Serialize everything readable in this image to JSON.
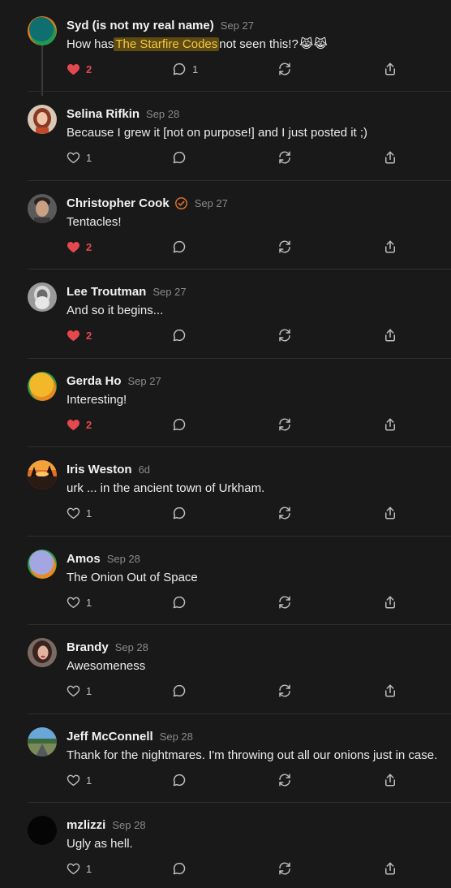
{
  "colors": {
    "background": "#191919",
    "accent_like": "#e5484d",
    "highlight_bg": "#5e4b12",
    "highlight_text": "#f6c744",
    "muted": "#8a8a8a"
  },
  "comments": [
    {
      "author": "Syd (is not my real name)",
      "date": "Sep 27",
      "text_before": "How has ",
      "highlight": "The Starfire Codes",
      "text_after": " not seen this!?",
      "emoji": "😹😹",
      "likes": "2",
      "liked": true,
      "replies": "1",
      "verified": false,
      "avatar": "teal-green-orange-circle"
    },
    {
      "author": "Selina Rifkin",
      "date": "Sep 28",
      "text": "Because I grew it [not on purpose!] and I just posted it ;)",
      "likes": "1",
      "liked": false,
      "replies": "",
      "verified": false,
      "avatar": "photo-woman-red-hair"
    },
    {
      "author": "Christopher Cook",
      "date": "Sep 27",
      "text": "Tentacles!",
      "likes": "2",
      "liked": true,
      "replies": "",
      "verified": true,
      "avatar": "photo-man-dark-hair"
    },
    {
      "author": "Lee Troutman",
      "date": "Sep 27",
      "text": "And so it begins...",
      "likes": "2",
      "liked": true,
      "replies": "",
      "verified": false,
      "avatar": "photo-grey-beard-bw"
    },
    {
      "author": "Gerda Ho",
      "date": "Sep 27",
      "text": "Interesting!",
      "likes": "2",
      "liked": true,
      "replies": "",
      "verified": false,
      "avatar": "yellow-orange-green-circle"
    },
    {
      "author": "Iris Weston",
      "date": "6d",
      "text": "urk ... in the ancient town of Urkham.",
      "likes": "1",
      "liked": false,
      "replies": "",
      "verified": false,
      "avatar": "photo-sunset-trees"
    },
    {
      "author": "Amos",
      "date": "Sep 28",
      "text": "The Onion Out of Space",
      "likes": "1",
      "liked": false,
      "replies": "",
      "verified": false,
      "avatar": "lavender-green-orange-circle"
    },
    {
      "author": "Brandy",
      "date": "Sep 28",
      "text": "Awesomeness",
      "likes": "1",
      "liked": false,
      "replies": "",
      "verified": false,
      "avatar": "photo-woman-dark-hair"
    },
    {
      "author": "Jeff McConnell",
      "date": "Sep 28",
      "text": "Thank for the nightmares. I'm throwing out all our onions just in case.",
      "likes": "1",
      "liked": false,
      "replies": "",
      "verified": false,
      "avatar": "photo-road-landscape"
    },
    {
      "author": "mzlizzi",
      "date": "Sep 28",
      "text": "Ugly as hell.",
      "likes": "1",
      "liked": false,
      "replies": "",
      "verified": false,
      "avatar": "black-circle"
    }
  ]
}
